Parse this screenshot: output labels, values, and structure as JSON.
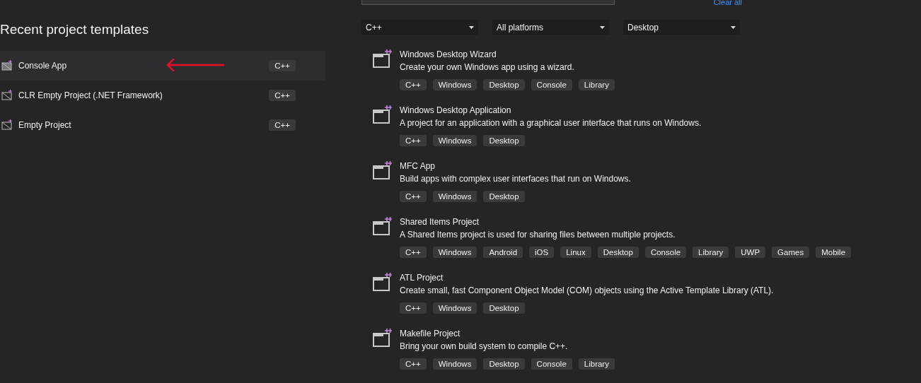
{
  "recent": {
    "heading": "Recent project templates",
    "items": [
      {
        "name": "Console App",
        "tag": "C++",
        "selected": true
      },
      {
        "name": "CLR Empty Project (.NET Framework)",
        "tag": "C++",
        "selected": false
      },
      {
        "name": "Empty Project",
        "tag": "C++",
        "selected": false
      }
    ]
  },
  "search": {
    "clear_link": "Clear all"
  },
  "filters": [
    {
      "value": "C++"
    },
    {
      "value": "All platforms"
    },
    {
      "value": "Desktop"
    }
  ],
  "templates": [
    {
      "title": "Windows Desktop Wizard",
      "description": "Create your own Windows app using a wizard.",
      "tags": [
        "C++",
        "Windows",
        "Desktop",
        "Console",
        "Library"
      ]
    },
    {
      "title": "Windows Desktop Application",
      "description": "A project for an application with a graphical user interface that runs on Windows.",
      "tags": [
        "C++",
        "Windows",
        "Desktop"
      ]
    },
    {
      "title": "MFC App",
      "description": "Build apps with complex user interfaces that run on Windows.",
      "tags": [
        "C++",
        "Windows",
        "Desktop"
      ]
    },
    {
      "title": "Shared Items Project",
      "description": "A Shared Items project is used for sharing files between multiple projects.",
      "tags": [
        "C++",
        "Windows",
        "Android",
        "iOS",
        "Linux",
        "Desktop",
        "Console",
        "Library",
        "UWP",
        "Games",
        "Mobile"
      ]
    },
    {
      "title": "ATL Project",
      "description": "Create small, fast Component Object Model (COM) objects using the Active Template Library (ATL).",
      "tags": [
        "C++",
        "Windows",
        "Desktop"
      ]
    },
    {
      "title": "Makefile Project",
      "description": "Bring your own build system to compile C++.",
      "tags": [
        "C++",
        "Windows",
        "Desktop",
        "Console",
        "Library"
      ]
    }
  ]
}
